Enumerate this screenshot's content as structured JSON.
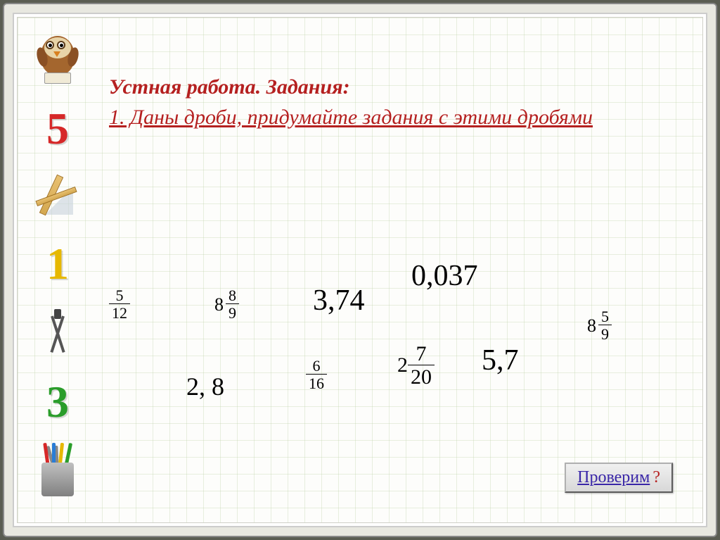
{
  "heading": {
    "title": "Устная работа. Задания:",
    "subtitle": "1. Даны дроби, придумайте задания с этими дробями"
  },
  "math": {
    "f1_num": "5",
    "f1_den": "12",
    "f2_whole": "8",
    "f2_num": "8",
    "f2_den": "9",
    "d1": "3,74",
    "d2": "0,037",
    "d3": "2, 8",
    "f3_num": "6",
    "f3_den": "16",
    "f4_whole": "2",
    "f4_num": "7",
    "f4_den": "20",
    "d4": "5,7",
    "f5_whole": "8",
    "f5_num": "5",
    "f5_den": "9"
  },
  "button": {
    "label": "Проверим",
    "qmark": "?"
  },
  "sidebar": {
    "num5": "5",
    "num1": "1",
    "num3": "3"
  }
}
